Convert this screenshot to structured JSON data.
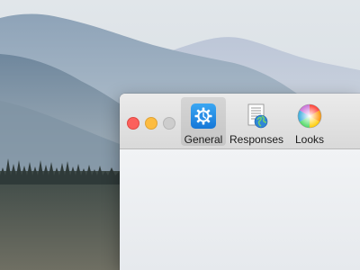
{
  "window": {
    "traffic_lights": [
      {
        "role": "close",
        "color": "#fc605c"
      },
      {
        "role": "minimize",
        "color": "#fdbc40"
      },
      {
        "role": "zoom",
        "color": "#cdcdcd"
      }
    ],
    "toolbar": {
      "tabs": [
        {
          "label": "General",
          "icon": "gear-icon",
          "selected": true
        },
        {
          "label": "Responses",
          "icon": "document-globe-icon",
          "selected": false
        },
        {
          "label": "Looks",
          "icon": "color-wheel-icon",
          "selected": false
        }
      ]
    }
  },
  "colors": {
    "accent_blue": "#1e88e5",
    "toolbar_bg": "#e0e0e0"
  }
}
